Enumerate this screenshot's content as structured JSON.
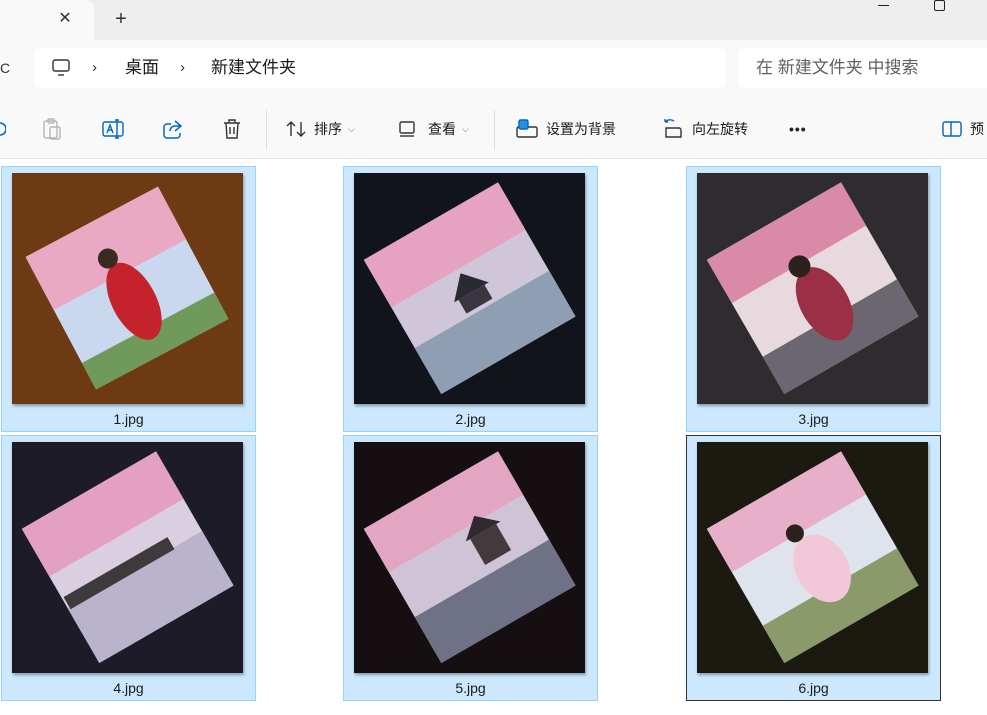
{
  "tab": {
    "close_glyph": "✕",
    "new_glyph": "+"
  },
  "nav": {
    "glyph": "C"
  },
  "breadcrumb": {
    "items": [
      "桌面",
      "新建文件夹"
    ],
    "separator": "›"
  },
  "search": {
    "placeholder": "在 新建文件夹 中搜索"
  },
  "toolbar": {
    "sort_label": "排序",
    "view_label": "查看",
    "set_background_label": "设置为背景",
    "rotate_left_label": "向左旋转",
    "more_label": "•••",
    "preview_label": "预"
  },
  "files": [
    {
      "name": "1.jpg",
      "bg": "#6e3a14"
    },
    {
      "name": "2.jpg",
      "bg": "#12141b"
    },
    {
      "name": "3.jpg",
      "bg": "#2e2c2f"
    },
    {
      "name": "4.jpg",
      "bg": "#1c1b27"
    },
    {
      "name": "5.jpg",
      "bg": "#150f12"
    },
    {
      "name": "6.jpg",
      "bg": "#1c1a10"
    }
  ],
  "colors": {
    "selection": "#cce8ff",
    "selection_border": "#99d1ff",
    "accent": "#0067c0"
  },
  "icons": [
    "close-icon",
    "new-tab-icon",
    "minimize-icon",
    "maximize-icon",
    "this-pc-icon",
    "chevron-right-icon",
    "copy-icon",
    "paste-icon",
    "rename-icon",
    "share-icon",
    "delete-icon",
    "sort-icon",
    "view-icon",
    "set-background-icon",
    "rotate-left-icon",
    "more-icon",
    "preview-pane-icon"
  ]
}
